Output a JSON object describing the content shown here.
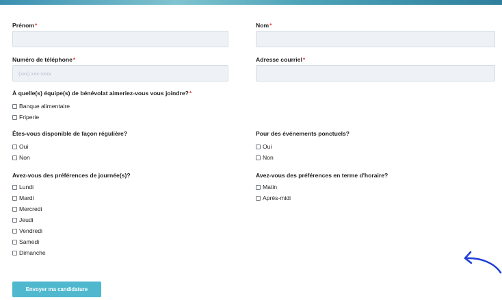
{
  "fields": {
    "first_name": {
      "label": "Prénom",
      "required": "*",
      "value": ""
    },
    "last_name": {
      "label": "Nom",
      "required": "*",
      "value": ""
    },
    "phone": {
      "label": "Numéro de téléphone",
      "required": "*",
      "value": "",
      "placeholder": "(xxx) xxx-xxxx"
    },
    "email": {
      "label": "Adresse courriel",
      "required": "*",
      "value": ""
    }
  },
  "teams": {
    "question": "À quelle(s) équipe(s) de bénévolat aimeriez-vous vous joindre?",
    "required": "*",
    "options": [
      "Banque alimentaire",
      "Friperie"
    ]
  },
  "regular": {
    "question": "Êtes-vous disponible de façon régulière?",
    "options": [
      "Oui",
      "Non"
    ]
  },
  "events": {
    "question": "Pour des événements ponctuels?",
    "options": [
      "Oui",
      "Non"
    ]
  },
  "days": {
    "question": "Avez-vous des préférences de journée(s)?",
    "options": [
      "Lundi",
      "Mardi",
      "Mercredi",
      "Jeudi",
      "Vendredi",
      "Samedi",
      "Dimanche"
    ]
  },
  "schedule": {
    "question": "Avez-vous des préférences en terme d'horaire?",
    "options": [
      "Matin",
      "Après-midi"
    ]
  },
  "submit": {
    "label": "Envoyer ma candidature"
  },
  "colors": {
    "accent": "#4fb8cf",
    "required": "#e0413a",
    "input_bg": "#eef2f7",
    "arrow": "#1f3fd6"
  }
}
